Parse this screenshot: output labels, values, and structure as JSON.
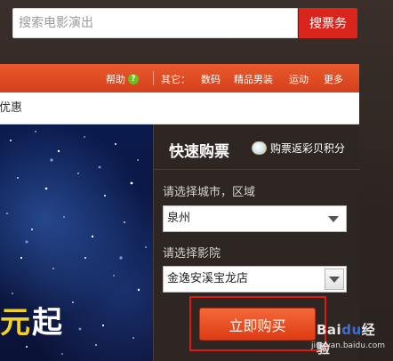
{
  "search": {
    "placeholder": "搜索电影演出",
    "button_label": "搜票务"
  },
  "nav": {
    "help_label": "帮助",
    "other_label": "其它：",
    "links": [
      "数码",
      "精品男装",
      "运动",
      "更多"
    ]
  },
  "promo": {
    "text": "优惠"
  },
  "banner": {
    "text_part1": "元",
    "text_part2": "起"
  },
  "quick_buy": {
    "title": "快速购票",
    "bonus_label": "购票返彩贝积分",
    "city_label": "请选择城市，区域",
    "city_value": "泉州",
    "cinema_label": "请选择影院",
    "cinema_value": "金逸安溪宝龙店",
    "buy_button_label": "立即购买"
  },
  "watermark": {
    "logo_letters": "Bai",
    "logo_rest": "du",
    "logo_suffix": "经验",
    "url": "jingyan.baidu.com"
  },
  "colors": {
    "accent_red": "#d9251b",
    "nav_orange": "#e95a2c",
    "panel_bg": "#2d2622",
    "help_green": "#6cc01e"
  }
}
